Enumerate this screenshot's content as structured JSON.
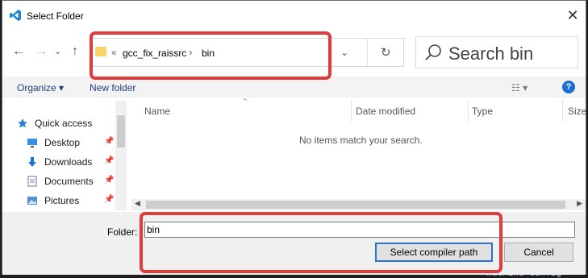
{
  "window": {
    "title": "Select Folder",
    "close_glyph": "✕"
  },
  "navigation": {
    "back": "←",
    "forward": "→",
    "recent": "⌄",
    "up": "↑",
    "breadcrumb_overflow": "«",
    "breadcrumb": [
      "gcc_fix_raissrc",
      "bin"
    ],
    "separator": "›",
    "dropdown": "⌄",
    "refresh": "↻"
  },
  "search": {
    "placeholder": "Search bin"
  },
  "toolbar": {
    "organize": "Organize ▾",
    "new_folder": "New folder",
    "view": "☷ ▾",
    "help": "?"
  },
  "nav_pane": {
    "items": [
      {
        "label": "Quick access",
        "icon": "star-icon"
      },
      {
        "label": "Desktop",
        "icon": "desktop-icon",
        "pinned": true
      },
      {
        "label": "Downloads",
        "icon": "download-icon",
        "pinned": true
      },
      {
        "label": "Documents",
        "icon": "documents-icon",
        "pinned": true
      },
      {
        "label": "Pictures",
        "icon": "pictures-icon",
        "pinned": true
      }
    ],
    "pin_glyph": "📌"
  },
  "file_list": {
    "columns": [
      "Name",
      "Date modified",
      "Type",
      "Size"
    ],
    "empty_message": "No items match your search."
  },
  "footer": {
    "folder_label": "Folder:",
    "folder_value": "bin",
    "select_button": "Select compiler path",
    "cancel_button": "Cancel"
  },
  "background_text": "~ machine config",
  "colors": {
    "highlight": "#e03c3c",
    "accent": "#1c6fd1",
    "link": "#1f3f7a"
  }
}
